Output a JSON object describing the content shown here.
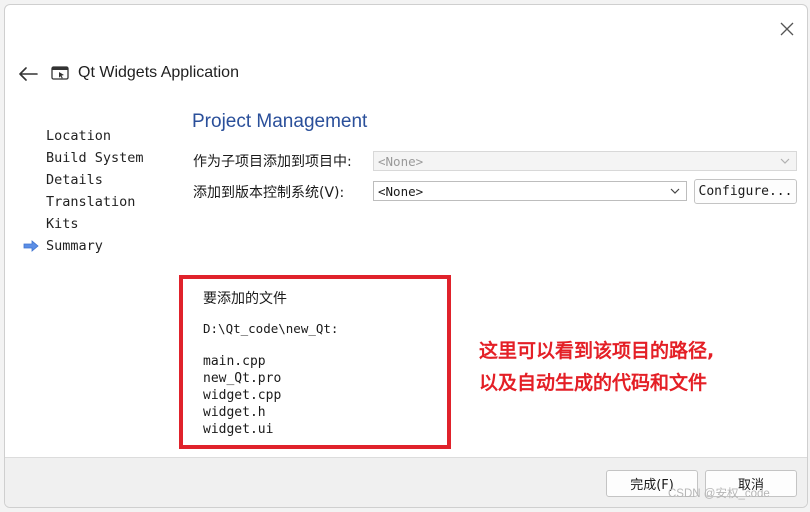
{
  "window": {
    "title": "Qt Widgets Application",
    "close_icon": "close-icon",
    "back_icon": "back-arrow-icon"
  },
  "steps": {
    "items": [
      {
        "label": "Location"
      },
      {
        "label": "Build System"
      },
      {
        "label": "Details"
      },
      {
        "label": "Translation"
      },
      {
        "label": "Kits"
      },
      {
        "label": "Summary",
        "current": true
      }
    ]
  },
  "page": {
    "heading": "Project Management",
    "subproject_label": "作为子项目添加到项目中:",
    "subproject_value": "<None>",
    "vcs_label": "添加到版本控制系统(V):",
    "vcs_value": "<None>",
    "configure_label": "Configure..."
  },
  "files": {
    "heading": "要添加的文件",
    "path": "D:\\Qt_code\\new_Qt:",
    "list": [
      "main.cpp",
      "new_Qt.pro",
      "widget.cpp",
      "widget.h",
      "widget.ui"
    ]
  },
  "annotation": {
    "line1": "这里可以看到该项目的路径,",
    "line2": "以及自动生成的代码和文件"
  },
  "footer": {
    "finish_label": "完成(F)",
    "cancel_label": "取消"
  },
  "watermark": "CSDN @安权_code",
  "colors": {
    "accent": "#2a4f9a",
    "annotation_red": "#e41f26",
    "step_arrow": "#5b8ee6"
  }
}
